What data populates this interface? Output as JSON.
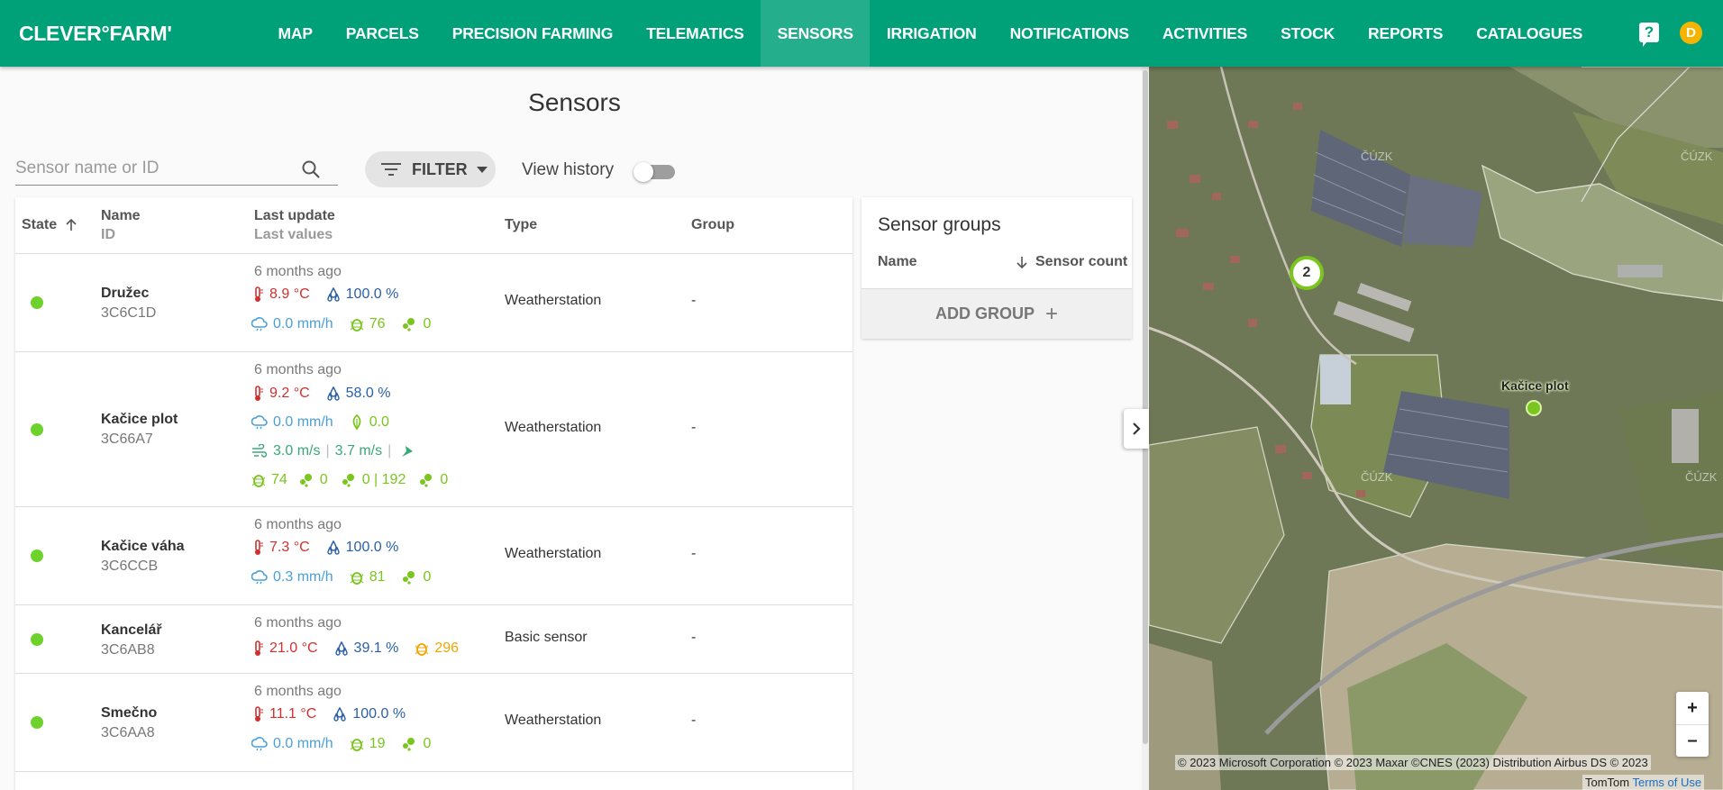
{
  "app": {
    "logo": "CLEVER°FARM'",
    "nav": [
      {
        "label": "MAP",
        "active": false
      },
      {
        "label": "PARCELS",
        "active": false
      },
      {
        "label": "PRECISION FARMING",
        "active": false
      },
      {
        "label": "TELEMATICS",
        "active": false
      },
      {
        "label": "SENSORS",
        "active": true
      },
      {
        "label": "IRRIGATION",
        "active": false
      },
      {
        "label": "NOTIFICATIONS",
        "active": false
      },
      {
        "label": "ACTIVITIES",
        "active": false
      },
      {
        "label": "STOCK",
        "active": false
      },
      {
        "label": "REPORTS",
        "active": false
      },
      {
        "label": "CATALOGUES",
        "active": false
      }
    ],
    "help_icon": "help-icon",
    "avatar_initial": "D",
    "colors": {
      "brand": "#00a179",
      "status_ok": "#6ed12c",
      "avatar": "#f5b400"
    }
  },
  "page": {
    "title": "Sensors",
    "search_placeholder": "Sensor name or ID",
    "search_value": "",
    "filter_label": "FILTER",
    "view_history_label": "View history",
    "view_history_on": false
  },
  "table": {
    "headers": {
      "state": "State",
      "name": "Name",
      "id": "ID",
      "last_update": "Last update",
      "last_values": "Last values",
      "type": "Type",
      "group": "Group"
    },
    "rows": [
      {
        "name": "Družec",
        "id": "3C6C1D",
        "updated": "6 months ago",
        "temp": "8.9 °C",
        "humidity": "100.0 %",
        "rain": "0.0 mm/h",
        "disease": "76",
        "drops": "0",
        "type": "Weatherstation",
        "group": "-"
      },
      {
        "name": "Kačice plot",
        "id": "3C66A7",
        "updated": "6 months ago",
        "temp": "9.2 °C",
        "humidity": "58.0 %",
        "rain": "0.0 mm/h",
        "leaf": "0.0",
        "wind1": "3.0 m/s",
        "wind2": "3.7 m/s",
        "disease": "74",
        "drops": "0",
        "drops2": "0 | 192",
        "drops3": "0",
        "type": "Weatherstation",
        "group": "-"
      },
      {
        "name": "Kačice váha",
        "id": "3C6CCB",
        "updated": "6 months ago",
        "temp": "7.3 °C",
        "humidity": "100.0 %",
        "rain": "0.3 mm/h",
        "disease": "81",
        "drops": "0",
        "type": "Weatherstation",
        "group": "-"
      },
      {
        "name": "Kancelář",
        "id": "3C6AB8",
        "updated": "6 months ago",
        "temp": "21.0 °C",
        "humidity": "39.1 %",
        "disease": "296",
        "type": "Basic sensor",
        "group": "-"
      },
      {
        "name": "Smečno",
        "id": "3C6AA8",
        "updated": "6 months ago",
        "temp": "11.1 °C",
        "humidity": "100.0 %",
        "rain": "0.0 mm/h",
        "disease": "19",
        "drops": "0",
        "type": "Weatherstation",
        "group": "-"
      }
    ]
  },
  "groups": {
    "title": "Sensor groups",
    "col_name": "Name",
    "col_count": "Sensor count",
    "add_label": "ADD GROUP"
  },
  "map": {
    "cluster_count": "2",
    "marker_label": "Kačice plot",
    "zoom_in": "+",
    "zoom_out": "–",
    "attribution": "© 2023 Microsoft Corporation © 2023 Maxar ©CNES (2023) Distribution Airbus DS © 2023",
    "attribution2_prefix": "TomTom",
    "attribution2_link": "Terms of Use",
    "watermark": "ČÚZK"
  }
}
